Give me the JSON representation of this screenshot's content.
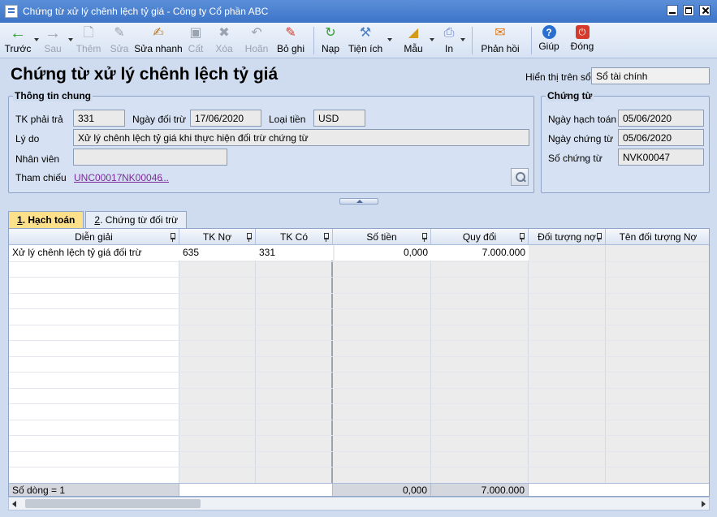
{
  "window": {
    "title": "Chứng từ xử lý chênh lệch tỷ giá - Công ty Cổ phần ABC"
  },
  "toolbar": {
    "items": [
      {
        "label": "Trước",
        "icon": "arrow-left-icon",
        "enabled": true
      },
      {
        "label": "Sau",
        "icon": "arrow-right-icon",
        "enabled": false
      },
      {
        "label": "Thêm",
        "icon": "new-document-icon",
        "enabled": false
      },
      {
        "label": "Sửa",
        "icon": "edit-document-icon",
        "enabled": false
      },
      {
        "label": "Sửa nhanh",
        "icon": "quick-edit-icon",
        "enabled": true
      },
      {
        "label": "Cất",
        "icon": "save-icon",
        "enabled": false
      },
      {
        "label": "Xóa",
        "icon": "delete-icon",
        "enabled": false
      },
      {
        "label": "Hoãn",
        "icon": "undo-icon",
        "enabled": false
      },
      {
        "label": "Bỏ ghi",
        "icon": "unpost-icon",
        "enabled": true
      },
      {
        "label": "Nạp",
        "icon": "reload-icon",
        "enabled": true
      },
      {
        "label": "Tiện ích",
        "icon": "utilities-icon",
        "enabled": true
      },
      {
        "label": "Mẫu",
        "icon": "template-icon",
        "enabled": true
      },
      {
        "label": "In",
        "icon": "print-icon",
        "enabled": true
      },
      {
        "label": "Phản hồi",
        "icon": "feedback-mail-icon",
        "enabled": true
      },
      {
        "label": "Giúp",
        "icon": "help-icon",
        "enabled": true
      },
      {
        "label": "Đóng",
        "icon": "close-power-icon",
        "enabled": true
      }
    ],
    "colors": {
      "back_arrow": "#2e9e2e",
      "feedback": "#e07a1a",
      "help": "#2a6fd0",
      "close": "#d63a2a"
    }
  },
  "header": {
    "title": "Chứng từ xử lý chênh lệch tỷ giá",
    "display_on_label": "Hiển thị trên sổ",
    "display_on_value": "Sổ tài chính"
  },
  "general": {
    "group_title": "Thông tin chung",
    "tk_phai_tra_label": "TK phải trả",
    "tk_phai_tra_value": "331",
    "ngay_doi_tru_label": "Ngày đối trừ",
    "ngay_doi_tru_value": "17/06/2020",
    "loai_tien_label": "Loại tiền",
    "loai_tien_value": "USD",
    "ly_do_label": "Lý do",
    "ly_do_value": "Xử lý chênh lệch tỷ giá khi thực hiện đối trừ chứng từ",
    "nhan_vien_label": "Nhân viên",
    "nhan_vien_value": "",
    "tham_chieu_label": "Tham chiếu",
    "ref1": "UNC00017",
    "ref2": "NK00046",
    "ref_more": "..."
  },
  "voucher": {
    "group_title": "Chứng từ",
    "ngay_hach_toan_label": "Ngày hạch toán",
    "ngay_hach_toan_value": "05/06/2020",
    "ngay_chung_tu_label": "Ngày chứng từ",
    "ngay_chung_tu_value": "05/06/2020",
    "so_chung_tu_label": "Số chứng từ",
    "so_chung_tu_value": "NVK00047"
  },
  "tabs": [
    {
      "num": "1",
      "label": ". Hạch toán",
      "active": true
    },
    {
      "num": "2",
      "label": ". Chứng từ đối trừ",
      "active": false
    }
  ],
  "grid": {
    "columns": [
      "Diễn giải",
      "TK Nợ",
      "TK Có",
      "Số tiền",
      "Quy đổi",
      "Đối tượng nợ",
      "Tên đối tượng Nợ"
    ],
    "rows": [
      {
        "dien_giai": "Xử lý chênh lệch tỷ giá đối trừ",
        "tk_no": "635",
        "tk_co": "331",
        "so_tien": "0,000",
        "quy_doi": "7.000.000",
        "doi_tuong_no": "",
        "ten_doi_tuong_no": ""
      }
    ],
    "footer": {
      "row_count": "Số dòng = 1",
      "total_so_tien": "0,000",
      "total_quy_doi": "7.000.000"
    }
  }
}
